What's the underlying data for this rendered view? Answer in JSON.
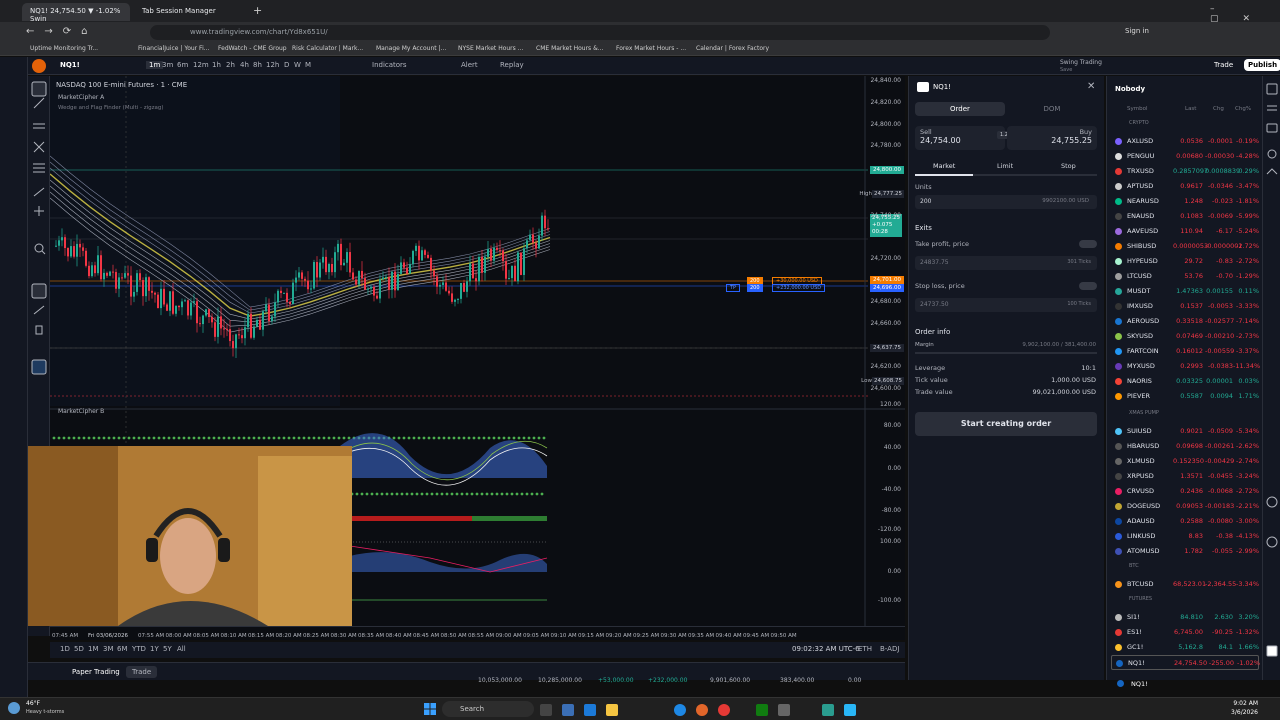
{
  "browser": {
    "tabs": [
      {
        "label": "NQ1! 24,754.50 ▼ -1.02% Swin"
      },
      {
        "label": "Tab Session Manager"
      }
    ],
    "url": "www.tradingview.com/chart/Yd8x651U/",
    "bookmarks": [
      "Uptime Monitoring Tr...",
      "FinancialJuice | Your Fi...",
      "FedWatch - CME Group",
      "Risk Calculator | Mark...",
      "Manage My Account |...",
      "NYSE Market Hours ...",
      "CME Market Hours &...",
      "Forex Market Hours - ...",
      "Calendar | Forex Factory"
    ],
    "sign_in": "Sign in"
  },
  "toolbar": {
    "symbol": "NQ1!",
    "intervals": [
      "1m",
      "3m",
      "6m",
      "12m",
      "1h",
      "2h",
      "4h",
      "8h",
      "12h",
      "D",
      "W",
      "M"
    ],
    "indicators": "Indicators",
    "alert": "Alert",
    "replay": "Replay",
    "layout": "Swing Trading",
    "layout_sub": "Save",
    "trade": "Trade",
    "publish": "Publish"
  },
  "chart": {
    "title": "NASDAQ 100 E-mini Futures · 1 · CME",
    "indicator1": "MarketCipher A",
    "indicator1b": "Wedge and Flag Finder (Multi - zigzag)",
    "indicator2": "MarketCipher B",
    "y_labels": [
      "24,840.00",
      "24,820.00",
      "24,800.00",
      "24,780.00",
      "24,760.00",
      "24,740.00",
      "24,720.00",
      "24,700.00",
      "24,680.00",
      "24,660.00",
      "24,640.00",
      "24,620.00",
      "24,600.00"
    ],
    "high_label": "High",
    "high_value": "24,777.25",
    "low_label": "Low",
    "low_value": "24,608.75",
    "price_tag": "24,755.25",
    "price_tag2": "+0.075",
    "price_tag3": "00:28",
    "level_800": "24,800.00",
    "level_701": "24,701.00",
    "level_696": "24,696.00",
    "level_637": "24,637.75",
    "tp_label": "TP",
    "qty_label": "200",
    "pos_pl": "+30,000.00 USD",
    "pos_tp": "+232,000.00 USD",
    "osc_labels": [
      "120.00",
      "80.00",
      "40.00",
      "0.00",
      "-40.00",
      "-80.00",
      "-120.00",
      "100.00",
      "0.00",
      "-100.00"
    ],
    "time_labels": [
      "07:45 AM",
      "Fri 03/06/2026",
      "07:55 AM",
      "08:00 AM",
      "08:05 AM",
      "08:10 AM",
      "08:15 AM",
      "08:20 AM",
      "08:25 AM",
      "08:30 AM",
      "08:35 AM",
      "08:40 AM",
      "08:45 AM",
      "08:50 AM",
      "08:55 AM",
      "09:00 AM",
      "09:05 AM",
      "09:10 AM",
      "09:15 AM",
      "09:20 AM",
      "09:25 AM",
      "09:30 AM",
      "09:35 AM",
      "09:40 AM",
      "09:45 AM",
      "09:50 AM"
    ],
    "ranges": [
      "1D",
      "5D",
      "1M",
      "3M",
      "6M",
      "YTD",
      "1Y",
      "5Y",
      "All"
    ],
    "clock": "09:02:32 AM UTC-6",
    "session": "ETH",
    "adj": "B-ADJ",
    "bottom_tabs": [
      "Paper Trading",
      "Trade"
    ],
    "bottom_values": [
      "10,053,000.00",
      "10,285,000.00",
      "+53,000.00",
      "+232,000.00",
      "9,901,600.00",
      "383,400.00",
      "0.00"
    ]
  },
  "order": {
    "symbol": "NQ1!",
    "tab_order": "Order",
    "tab_dom": "DOM",
    "sell_label": "Sell",
    "sell_price": "24,754.00",
    "spread": "1.25",
    "buy_label": "Buy",
    "buy_price": "24,755.25",
    "types": [
      "Market",
      "Limit",
      "Stop"
    ],
    "units_label": "Units",
    "units_value": "200",
    "units_usd": "9902100.00 USD",
    "exits": "Exits",
    "tp_label": "Take profit, price",
    "tp_value": "24837.75",
    "tp_ticks": "301 Ticks",
    "sl_label": "Stop loss, price",
    "sl_value": "24737.50",
    "sl_ticks": "100 Ticks",
    "info": "Order info",
    "margin_label": "Margin",
    "margin_value": "9,902,100.00 / 381,400.00",
    "leverage_label": "Leverage",
    "leverage_value": "10:1",
    "tick_label": "Tick value",
    "tick_value": "1,000.00 USD",
    "trade_label": "Trade value",
    "trade_value": "99,021,000.00 USD",
    "start_btn": "Start creating order"
  },
  "watchlist": {
    "name": "Nobody",
    "cols": [
      "Symbol",
      "Last",
      "Chg",
      "Chg%"
    ],
    "sections": [
      {
        "title": "CRYPTO",
        "rows": [
          [
            "AXLUSD",
            "0.0536",
            "-0.0001",
            "-0.19%",
            "#7b61ff"
          ],
          [
            "PENGUU",
            "0.00680",
            "-0.00030",
            "-4.28%",
            "#ddd"
          ],
          [
            "TRXUSD",
            "0.2857097",
            "0.0008839",
            "0.29%",
            "#e53935"
          ],
          [
            "APTUSD",
            "0.9617",
            "-0.0346",
            "-3.47%",
            "#ccc"
          ],
          [
            "NEARUSD",
            "1.248",
            "-0.023",
            "-1.81%",
            "#0b8"
          ],
          [
            "ENAUSD",
            "0.1083",
            "-0.0069",
            "-5.99%",
            "#444"
          ],
          [
            "AAVEUSD",
            "110.94",
            "-6.17",
            "-5.24%",
            "#9c6ade"
          ],
          [
            "SHIBUSD",
            "0.0000053",
            "-0.0000001",
            "-2.72%",
            "#f57c00"
          ],
          [
            "HYPEUSD",
            "29.72",
            "-0.83",
            "-2.72%",
            "#a7f3d0"
          ],
          [
            "LTCUSD",
            "53.76",
            "-0.70",
            "-1.29%",
            "#9e9e9e"
          ],
          [
            "MUSDT",
            "1.47363",
            "0.00155",
            "0.11%",
            "#26a69a"
          ],
          [
            "IMXUSD",
            "0.1537",
            "-0.0053",
            "-3.33%",
            "#333"
          ],
          [
            "AEROUSD",
            "0.33518",
            "-0.02577",
            "-7.14%",
            "#1976d2"
          ],
          [
            "SKYUSD",
            "0.07469",
            "-0.00210",
            "-2.73%",
            "#8bc34a"
          ],
          [
            "FARTCOIN",
            "0.16012",
            "-0.00559",
            "-3.37%",
            "#2196f3"
          ],
          [
            "MYXUSD",
            "0.2993",
            "-0.0383",
            "-11.34%",
            "#673ab7"
          ],
          [
            "NAORIS",
            "0.03325",
            "0.00001",
            "0.03%",
            "#f44336"
          ],
          [
            "PIEVER",
            "0.5587",
            "0.0094",
            "1.71%",
            "#ff9800"
          ]
        ]
      },
      {
        "title": "XMAS PUMP",
        "rows": [
          [
            "SUIUSD",
            "0.9021",
            "-0.0509",
            "-5.34%",
            "#4fc3f7"
          ],
          [
            "HBARUSD",
            "0.09698",
            "-0.00261",
            "-2.62%",
            "#555"
          ],
          [
            "XLMUSD",
            "0.152350",
            "-0.00429",
            "-2.74%",
            "#666"
          ],
          [
            "XRPUSD",
            "1.3571",
            "-0.0455",
            "-3.24%",
            "#444"
          ],
          [
            "CRVUSD",
            "0.2436",
            "-0.0068",
            "-2.72%",
            "#e91e63"
          ],
          [
            "DOGEUSD",
            "0.09053",
            "-0.00183",
            "-2.21%",
            "#c2a633"
          ],
          [
            "ADAUSD",
            "0.2588",
            "-0.0080",
            "-3.00%",
            "#0d47a1"
          ],
          [
            "LINKUSD",
            "8.83",
            "-0.38",
            "-4.13%",
            "#2a5ada"
          ],
          [
            "ATOMUSD",
            "1.782",
            "-0.055",
            "-2.99%",
            "#3f51b5"
          ]
        ]
      },
      {
        "title": "BTC",
        "rows": [
          [
            "BTCUSD",
            "68,523.01",
            "-2,364.55",
            "-3.34%",
            "#f7931a"
          ]
        ]
      },
      {
        "title": "FUTURES",
        "rows": [
          [
            "SI1!",
            "84.810",
            "2.630",
            "3.20%",
            "#bbb"
          ],
          [
            "ES1!",
            "6,745.00",
            "-90.25",
            "-1.32%",
            "#e53935"
          ],
          [
            "GC1!",
            "5,162.8",
            "84.1",
            "1.66%",
            "#fbc02d"
          ],
          [
            "NQ1!",
            "24,754.50",
            "-255.00",
            "-1.02%",
            "#1565c0"
          ]
        ]
      }
    ],
    "footer_symbol": "NQ1!"
  },
  "taskbar": {
    "temp": "46°F",
    "weather": "Heavy t-storms",
    "search": "Search",
    "time": "9:02 AM",
    "date": "3/6/2026"
  }
}
